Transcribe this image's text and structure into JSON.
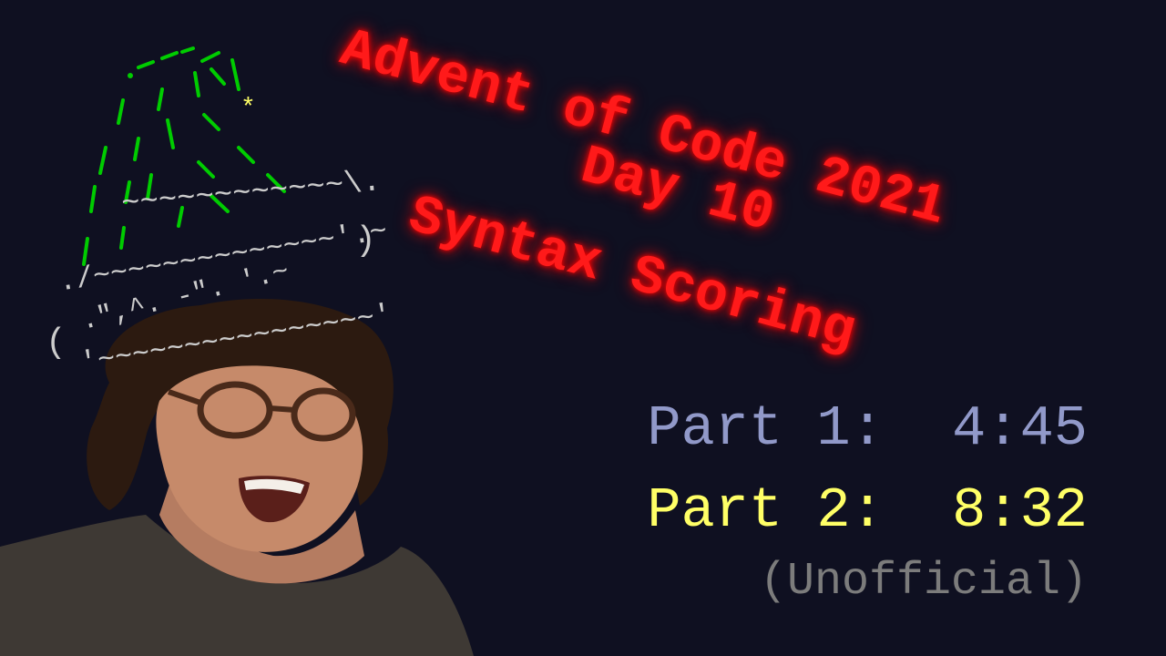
{
  "title": {
    "line1": "Advent of Code 2021",
    "line2": "Day 10",
    "line3": "Syntax Scoring"
  },
  "times": {
    "part1": "Part 1:  4:45",
    "part2": "Part 2:  8:32",
    "note": "(Unofficial)"
  },
  "hat": {
    "brim_top": "~~~~~~~~~~~~\\.",
    "brim_top_end": ")",
    "brim_mid": "./~~~~~~~~~~~~~~'.~",
    "brim_pattern": ".\",^. -\". '.~",
    "brim_left": "(",
    "brim_bottom": "'~~~~~~~~~~~~~~~~'",
    "star": "*"
  },
  "colors": {
    "background": "#0f1021",
    "title": "#ff1a1a",
    "part1": "#9199c9",
    "part2": "#ffff66",
    "note": "#7c7c7c",
    "hat_green": "#00cc00",
    "hat_brim": "#cccccc",
    "star": "#ffff66"
  }
}
